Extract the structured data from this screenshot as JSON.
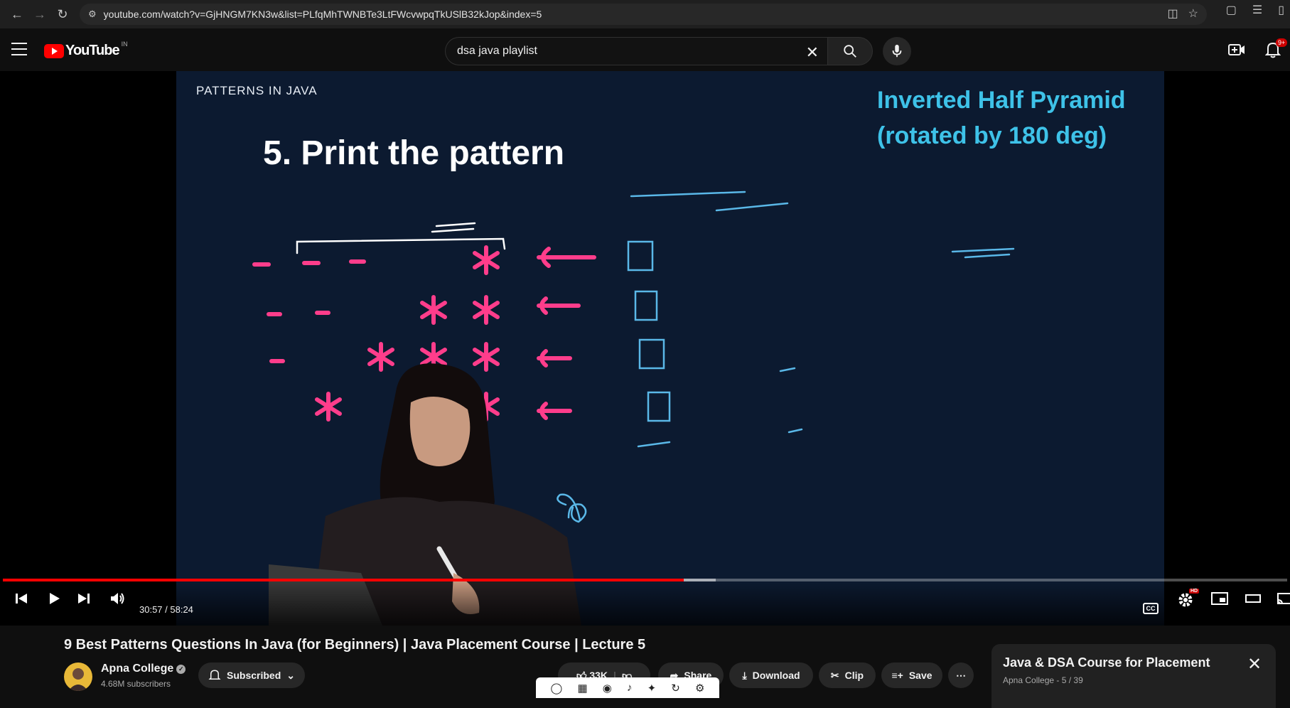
{
  "browser": {
    "url": "youtube.com/watch?v=GjHNGM7KN3w&list=PLfqMhTWNBTe3LtFWcvwpqTkUSlB32kJop&index=5"
  },
  "header": {
    "logo_text": "YouTube",
    "country": "IN",
    "search_value": "dsa java playlist",
    "notification_count": "9+"
  },
  "slide": {
    "subject": "PATTERNS IN JAVA",
    "title": "5. Print the pattern",
    "topic_line1": "Inverted Half Pyramid",
    "topic_line2": "(rotated by 180 deg)"
  },
  "player": {
    "current_time": "30:57",
    "duration": "58:24",
    "time_display": "30:57 / 58:24",
    "progress_fraction": 0.53,
    "loaded_fraction": 0.555,
    "cc_label": "CC",
    "hd_badge": "HD"
  },
  "video": {
    "title": "9 Best Patterns Questions In Java (for Beginners) | Java Placement Course | Lecture 5",
    "channel": "Apna College",
    "subscribers": "4.68M subscribers",
    "subscribe_label": "Subscribed",
    "likes": "33K",
    "share_label": "Share",
    "download_label": "Download",
    "clip_label": "Clip",
    "save_label": "Save"
  },
  "playlist": {
    "title": "Java & DSA Course for Placement",
    "subtitle": "Apna College - 5 / 39"
  },
  "colors": {
    "accent_red": "#ff0000",
    "slide_bg": "#0c1a30",
    "topic_cyan": "#3ec2e8",
    "ink_pink": "#ff3d8b",
    "ink_blue": "#5ab8e8"
  }
}
